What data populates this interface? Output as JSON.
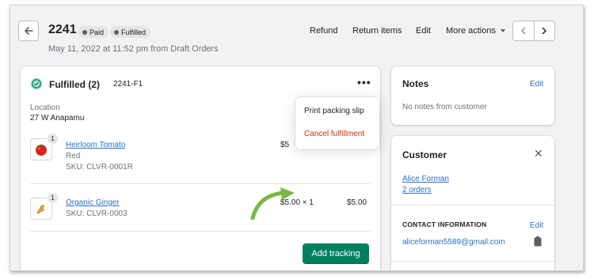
{
  "header": {
    "order_number": "2241",
    "badges": [
      {
        "label": "Paid"
      },
      {
        "label": "Fulfilled"
      }
    ],
    "subtitle": "May 11, 2022 at 11:52 pm from Draft Orders",
    "actions": {
      "refund": "Refund",
      "return_items": "Return items",
      "edit": "Edit",
      "more_actions": "More actions"
    }
  },
  "fulfillment": {
    "title": "Fulfilled (2)",
    "id": "2241-F1",
    "location_label": "Location",
    "location_value": "27 W Anapamu",
    "items": [
      {
        "quantity_badge": "1",
        "name": "Heirloom Tomato",
        "variant": "Red",
        "sku": "SKU: CLVR-0001R",
        "unit_price": "$5",
        "total": "",
        "icon": "tomato-icon"
      },
      {
        "quantity_badge": "1",
        "name": "Organic Ginger",
        "variant": "",
        "sku": "SKU: CLVR-0003",
        "unit_price": "$5.00 × 1",
        "total": "$5.00",
        "icon": "ginger-icon"
      }
    ],
    "add_tracking": "Add tracking",
    "menu": {
      "print": "Print packing slip",
      "cancel": "Cancel fulfillment"
    }
  },
  "notes": {
    "title": "Notes",
    "edit": "Edit",
    "empty": "No notes from customer"
  },
  "customer": {
    "title": "Customer",
    "name": "Alice Forman",
    "orders": "2 orders",
    "contact_heading": "CONTACT INFORMATION",
    "contact_edit": "Edit",
    "email": "aliceforman5589@gmail.com"
  },
  "colors": {
    "primary": "#008060",
    "link": "#2c6ecb",
    "critical": "#d72c0d",
    "arrow": "#7ab648"
  }
}
